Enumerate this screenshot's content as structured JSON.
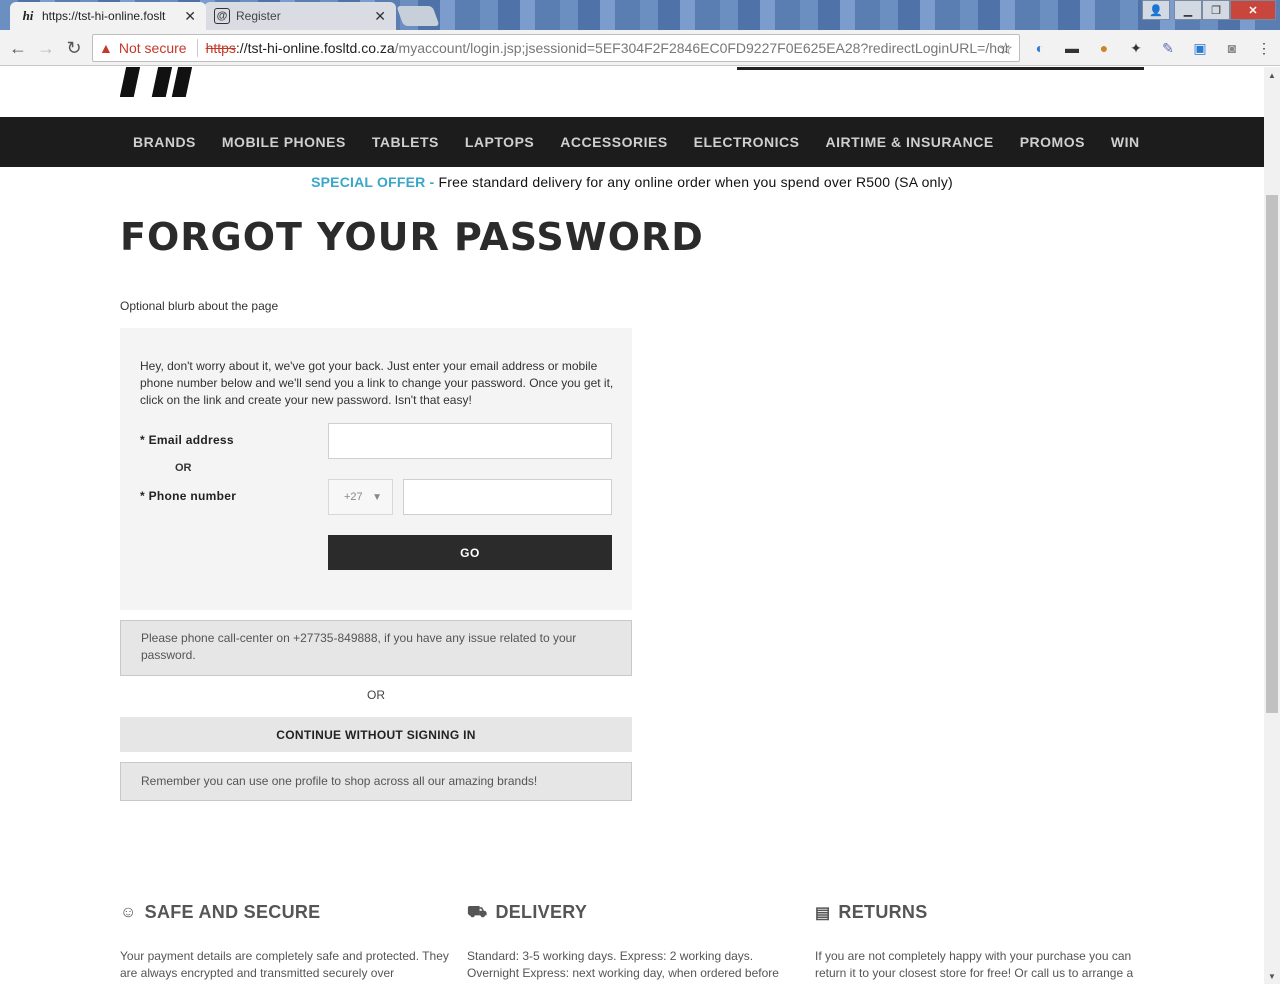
{
  "browser": {
    "tabs": [
      {
        "title": "https://tst-hi-online.foslt",
        "favicon": "hi"
      },
      {
        "title": "Register",
        "favicon": "@"
      }
    ],
    "omnibox": {
      "security_label": "Not secure",
      "scheme": "https",
      "host": "://tst-hi-online.fosltd.co.za",
      "path": "/myaccount/login.jsp;jsessionid=5EF304F2F2846EC0FD9227F0E625EA28?redirectLoginURL=/hor"
    }
  },
  "nav": {
    "items": [
      "BRANDS",
      "MOBILE PHONES",
      "TABLETS",
      "LAPTOPS",
      "ACCESSORIES",
      "ELECTRONICS",
      "AIRTIME & INSURANCE",
      "PROMOS",
      "WIN"
    ]
  },
  "offer": {
    "highlight": "SPECIAL OFFER",
    "dash": " - ",
    "text": "Free standard delivery for any online order when you spend over R500 (SA only)"
  },
  "page": {
    "title": "FORGOT YOUR PASSWORD",
    "blurb": "Optional blurb about the page"
  },
  "form": {
    "intro": "Hey, don't worry about it, we've got your back. Just enter your email address or mobile phone number below and we'll send you a link to change your password. Once you get it, click on the link and create your new password. Isn't that easy!",
    "email_label": "* Email address",
    "or": "OR",
    "phone_label": "* Phone number",
    "country_code": "+27",
    "go_label": "GO"
  },
  "notices": {
    "callcenter": "Please phone call-center on +27735-849888, if you have any issue related to your password.",
    "or": "OR",
    "continue_label": "CONTINUE WITHOUT SIGNING IN",
    "profile": "Remember you can use one profile to shop across all our amazing brands!"
  },
  "features": [
    {
      "title": "SAFE AND SECURE",
      "icon": "smiley-icon",
      "text": "Your payment details are completely safe and protected. They are always encrypted and transmitted securely over"
    },
    {
      "title": "DELIVERY",
      "icon": "truck-icon",
      "text": "Standard: 3-5 working days. Express: 2 working days. Overnight Express: next working day, when ordered before"
    },
    {
      "title": "RETURNS",
      "icon": "box-icon",
      "text": "If you are not completely happy with your purchase you can return it to your closest store for free! Or call us to arrange a"
    }
  ]
}
